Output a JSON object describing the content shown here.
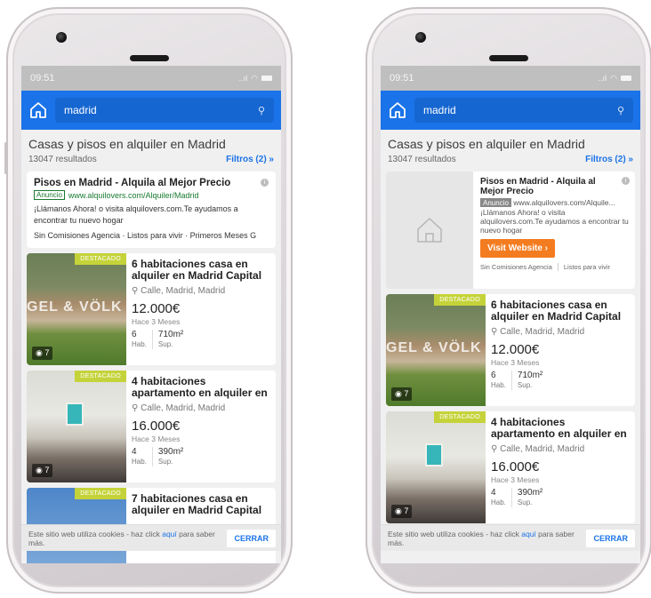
{
  "status": {
    "time": "09:51",
    "signal": "..ıl",
    "wifi": "◠"
  },
  "appbar": {
    "search_value": "madrid"
  },
  "results": {
    "title": "Casas y pisos en alquiler en Madrid",
    "count": "13047 resultados",
    "filters": "Filtros (2) »"
  },
  "ad_text": {
    "title": "Pisos en Madrid - Alquila al Mejor Precio",
    "badge": "Anuncio",
    "url": "www.alquilovers.com/Alquiler/Madrid",
    "body": "¡Llámanos Ahora! o visita alquilovers.com.Te ayudamos a encontrar tu nuevo hogar",
    "links": "Sin Comisiones Agencia · Listos para vivir · Primeros Meses G"
  },
  "ad_visual": {
    "title": "Pisos en Madrid - Alquila al Mejor Precio",
    "badge": "Anuncio",
    "url": "www.alquilovers.com/Alquile...",
    "body": "¡Llámanos Ahora! o visita alquilovers.com.Te ayudamos a encontrar tu nuevo hogar",
    "cta": "Visit Website ›",
    "link1": "Sin Comisiones Agencia",
    "link2": "Listos para vivir"
  },
  "listings": [
    {
      "badge": "DESTACADO",
      "title": "6 habitaciones casa en alquiler en Madrid Capital",
      "address": "Calle, Madrid, Madrid",
      "price": "12.000€",
      "time": "Hace 3 Meses",
      "rooms": "6",
      "rooms_label": "Hab.",
      "area": "710m²",
      "area_label": "Sup.",
      "photos": "7",
      "overlay": "GEL & VÖLK"
    },
    {
      "badge": "DESTACADO",
      "title": "4 habitaciones apartamento en alquiler en",
      "address": "Calle, Madrid, Madrid",
      "price": "16.000€",
      "time": "Hace 3 Meses",
      "rooms": "4",
      "rooms_label": "Hab.",
      "area": "390m²",
      "area_label": "Sup.",
      "photos": "7"
    },
    {
      "badge": "DESTACADO",
      "title": "7 habitaciones casa en alquiler en Madrid Capital"
    }
  ],
  "cookie": {
    "text_before": "Este sitio web utiliza cookies - haz click ",
    "link": "aquí",
    "text_after": " para saber más.",
    "button": "CERRAR"
  },
  "colors": {
    "primary": "#1a73e8",
    "badge": "#c5d33a",
    "cta": "#f47c20"
  }
}
